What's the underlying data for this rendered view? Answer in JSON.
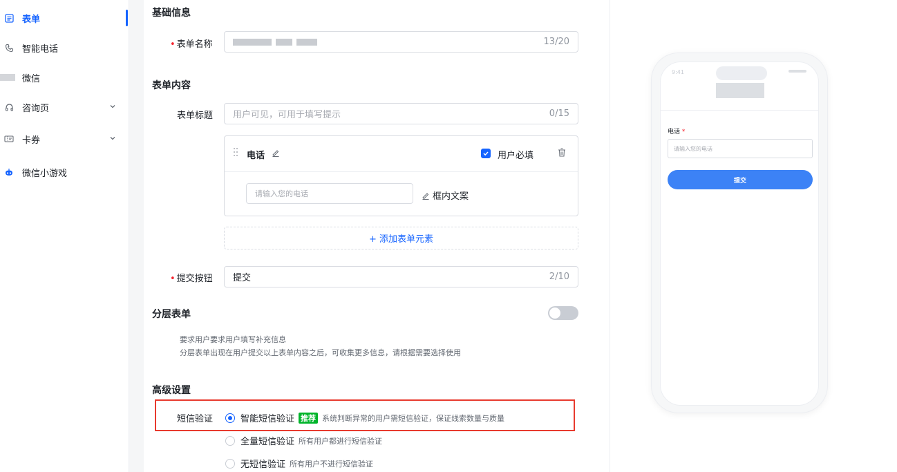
{
  "sidebar": {
    "items": [
      {
        "label": "表单",
        "icon": "form-icon",
        "active": true
      },
      {
        "label": "智能电话",
        "icon": "phone-icon"
      },
      {
        "label": "微信",
        "icon": "wechat-icon"
      },
      {
        "label": "咨询页",
        "icon": "headset-icon",
        "expandable": true
      },
      {
        "label": "卡券",
        "icon": "coupon-icon",
        "expandable": true
      },
      {
        "label": "微信小游戏",
        "icon": "game-icon"
      }
    ],
    "accent": "#1664ff"
  },
  "basic": {
    "section_title": "基础信息",
    "name_label": "表单名称",
    "name_count": "13/20"
  },
  "content": {
    "section_title": "表单内容",
    "title_label": "表单标题",
    "title_placeholder": "用户可见，可用于填写提示",
    "title_count": "0/15",
    "field": {
      "name": "电话",
      "required_label": "用户必填",
      "required_checked": true,
      "input_placeholder": "请输入您的电话",
      "edit_text_label": "框内文案"
    },
    "add_element_label": "+ 添加表单元素",
    "submit_label": "提交按钮",
    "submit_value": "提交",
    "submit_count": "2/10"
  },
  "layered": {
    "section_title": "分层表单",
    "enabled": false,
    "desc_1": "要求用户要求用户填写补充信息",
    "desc_2": "分层表单出现在用户提交以上表单内容之后，可收集更多信息，请根据需要选择使用"
  },
  "advanced": {
    "section_title": "高级设置",
    "sms_label": "短信验证",
    "options": [
      {
        "label": "智能短信验证",
        "badge": "推荐",
        "desc": "系统判断异常的用户需短信验证，保证线索数量与质量",
        "selected": true
      },
      {
        "label": "全量短信验证",
        "desc": "所有用户都进行短信验证",
        "selected": false
      },
      {
        "label": "无短信验证",
        "desc": "所有用户不进行短信验证",
        "selected": false
      }
    ]
  },
  "preview": {
    "time": "9:41",
    "field_label": "电话",
    "field_placeholder": "请输入您的电话",
    "submit_button": "提交"
  }
}
